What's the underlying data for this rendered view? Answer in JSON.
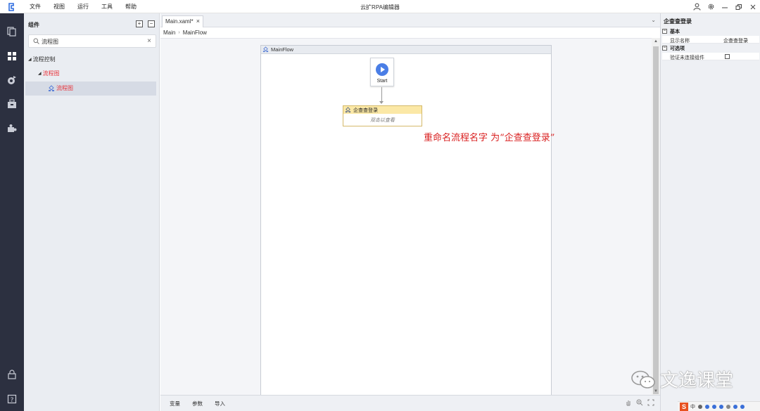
{
  "window": {
    "title": "云扩RPA编辑器"
  },
  "menu": [
    "文件",
    "视图",
    "运行",
    "工具",
    "帮助"
  ],
  "components_panel": {
    "title": "组件",
    "search": {
      "value": "流程图",
      "placeholder": ""
    },
    "tree": [
      {
        "label": "流程控制",
        "color": "#333333"
      },
      {
        "label": "流程图",
        "color": "#e8333a"
      },
      {
        "label": "流程图",
        "color": "#e8333a"
      }
    ]
  },
  "document": {
    "tab_label": "Main.xaml*",
    "breadcrumb": [
      "Main",
      "MainFlow"
    ],
    "flow_title": "MainFlow",
    "start_label": "Start",
    "activity": {
      "title": "企查查登录",
      "body": "双击以查看"
    },
    "bottom_tabs": [
      "变量",
      "参数",
      "导入"
    ]
  },
  "annotation": "重命名流程名字 为“企查查登录”",
  "properties": {
    "title": "企查查登录",
    "categories": [
      {
        "label": "基本",
        "rows": [
          {
            "key": "显示名称",
            "value": "企查查登录"
          }
        ]
      },
      {
        "label": "可选项",
        "rows": [
          {
            "key": "验证未连接组件",
            "checked": false
          }
        ]
      }
    ]
  },
  "watermark": "文逸课堂",
  "tray": {
    "lang": "中"
  },
  "colors": {
    "rail": "#2c3040",
    "accent": "#4a7ee6",
    "annotation": "#d92020",
    "activity_header": "#fbe8a6"
  }
}
